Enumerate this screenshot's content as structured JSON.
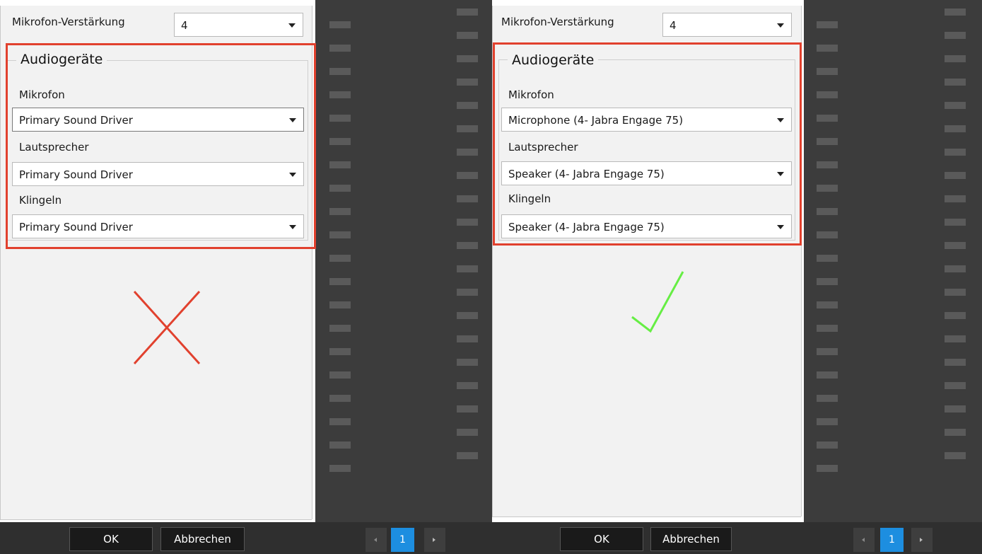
{
  "colors": {
    "dark_bg": "#3c3c3c",
    "panel_bg": "#f2f2f2",
    "highlight_border": "#e1412e",
    "cross_mark": "#e1412e",
    "check_mark": "#66ee44",
    "pager_current": "#1d8ee0"
  },
  "left": {
    "gain_label": "Mikrofon-Verstärkung",
    "gain_value": "4",
    "group_title": "Audiogeräte",
    "mic_label": "Mikrofon",
    "mic_value": "Primary Sound Driver",
    "speaker_label": "Lautsprecher",
    "speaker_value": "Primary Sound Driver",
    "ring_label": "Klingeln",
    "ring_value": "Primary Sound Driver",
    "verdict_icon": "cross-mark-icon",
    "ok_label": "OK",
    "cancel_label": "Abbrechen",
    "page_current": "1"
  },
  "right": {
    "gain_label": "Mikrofon-Verstärkung",
    "gain_value": "4",
    "group_title": "Audiogeräte",
    "mic_label": "Mikrofon",
    "mic_value": "Microphone (4- Jabra Engage 75)",
    "speaker_label": "Lautsprecher",
    "speaker_value": "Speaker (4- Jabra Engage 75)",
    "ring_label": "Klingeln",
    "ring_value": "Speaker (4- Jabra Engage 75)",
    "verdict_icon": "check-mark-icon",
    "ok_label": "OK",
    "cancel_label": "Abbrechen",
    "page_current": "1"
  }
}
